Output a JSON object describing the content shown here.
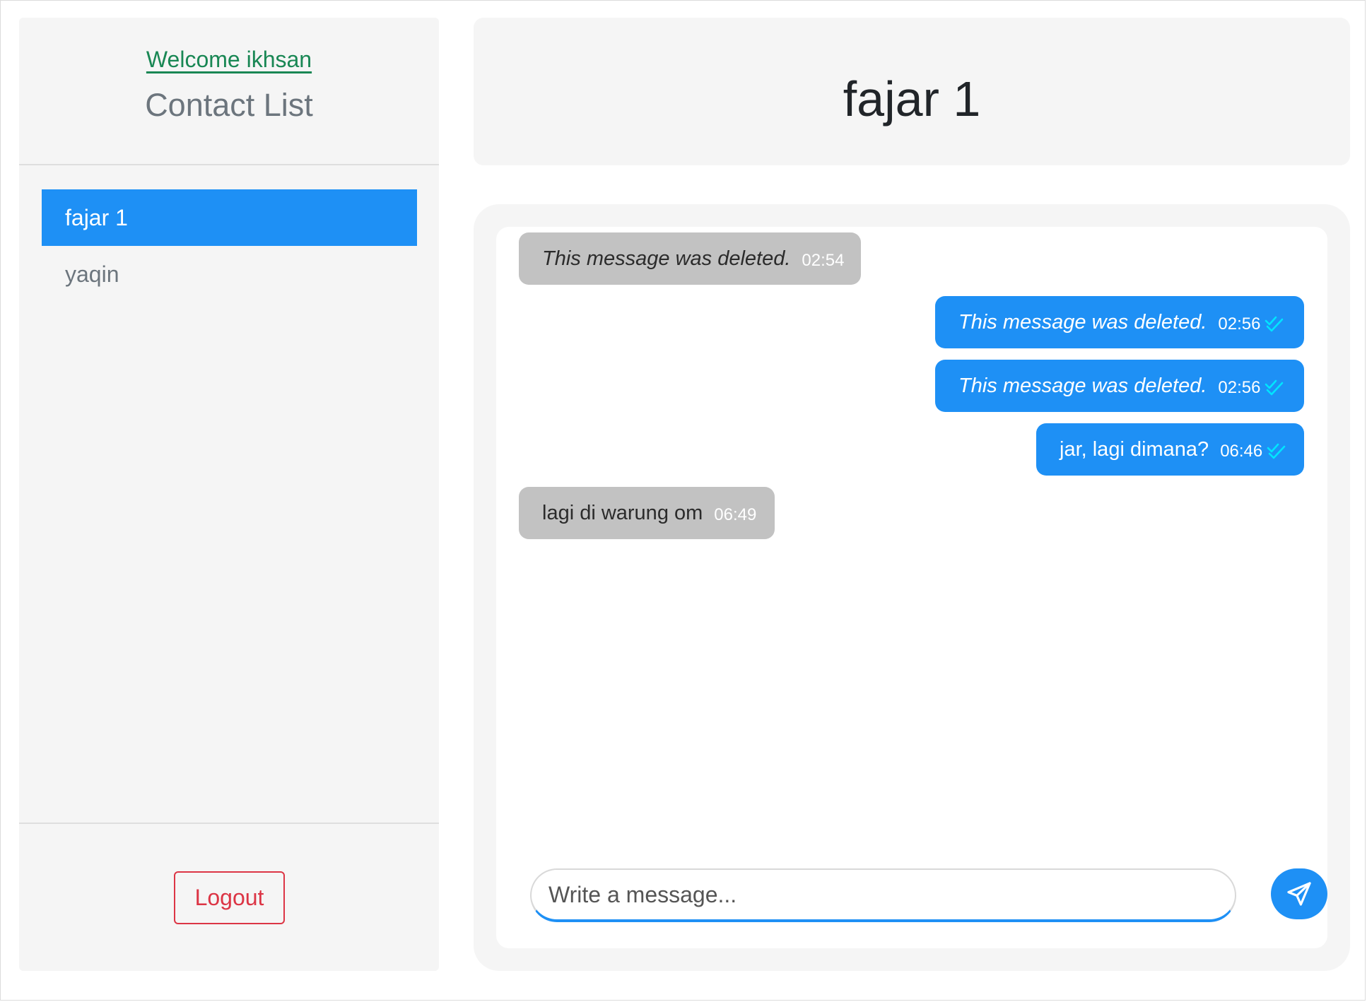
{
  "sidebar": {
    "welcome": "Welcome ikhsan",
    "title": "Contact List",
    "contacts": [
      {
        "name": "fajar 1",
        "active": true
      },
      {
        "name": "yaqin",
        "active": false
      }
    ],
    "logout_label": "Logout"
  },
  "chat": {
    "title": "fajar 1",
    "messages": [
      {
        "direction": "incoming",
        "text": "This message was deleted.",
        "deleted": true,
        "time": "02:54",
        "read_icon": null
      },
      {
        "direction": "outgoing",
        "text": "This message was deleted.",
        "deleted": true,
        "time": "02:56",
        "read_icon": "double-check-icon"
      },
      {
        "direction": "outgoing",
        "text": "This message was deleted.",
        "deleted": true,
        "time": "02:56",
        "read_icon": "double-check-icon"
      },
      {
        "direction": "outgoing",
        "text": "jar, lagi dimana?",
        "deleted": false,
        "time": "06:46",
        "read_icon": "double-check-icon"
      },
      {
        "direction": "incoming",
        "text": "lagi di warung om",
        "deleted": false,
        "time": "06:49",
        "read_icon": null
      }
    ],
    "composer": {
      "placeholder": "Write a message...",
      "value": "",
      "send_icon": "send-icon"
    }
  },
  "colors": {
    "accent": "#1e90f5",
    "welcome": "#198754",
    "logout": "#dc3545",
    "incoming_bubble": "#c2c2c2",
    "read_check": "#00e5ff",
    "panel_bg": "#f5f5f5"
  }
}
